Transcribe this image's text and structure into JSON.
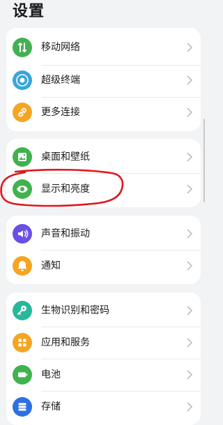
{
  "header": {
    "title": "设置"
  },
  "groups": [
    {
      "items": [
        {
          "label": "移动网络",
          "icon": "mobile-network-icon",
          "color": "#43b052"
        },
        {
          "label": "超级终端",
          "icon": "super-device-icon",
          "color": "#37a6dc"
        },
        {
          "label": "更多连接",
          "icon": "link-icon",
          "color": "#f5a523"
        }
      ]
    },
    {
      "items": [
        {
          "label": "桌面和壁纸",
          "icon": "wallpaper-icon",
          "color": "#40b24e"
        },
        {
          "label": "显示和亮度",
          "icon": "eye-icon",
          "color": "#40b24e"
        }
      ]
    },
    {
      "items": [
        {
          "label": "声音和振动",
          "icon": "speaker-icon",
          "color": "#6a4ee6"
        },
        {
          "label": "通知",
          "icon": "bell-icon",
          "color": "#f5a523"
        }
      ]
    },
    {
      "items": [
        {
          "label": "生物识别和密码",
          "icon": "key-icon",
          "color": "#26b89a"
        },
        {
          "label": "应用和服务",
          "icon": "apps-grid-icon",
          "color": "#f5a523"
        },
        {
          "label": "电池",
          "icon": "battery-icon",
          "color": "#40b24e"
        },
        {
          "label": "存储",
          "icon": "storage-icon",
          "color": "#2c6fe6"
        }
      ]
    }
  ],
  "annotation": {
    "color": "#e0161c"
  }
}
